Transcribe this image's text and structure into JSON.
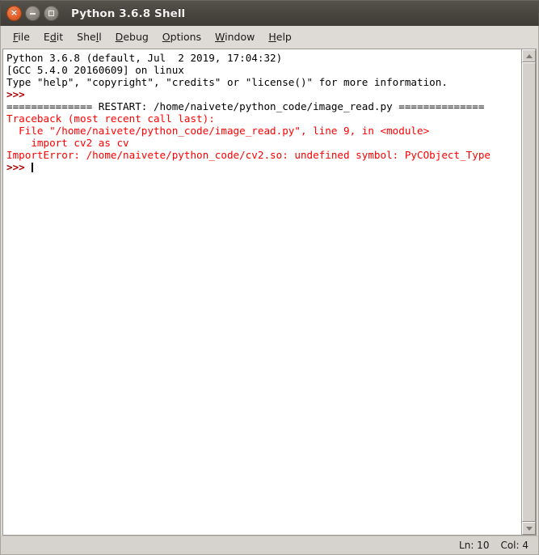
{
  "window": {
    "title": "Python 3.6.8 Shell",
    "controls": [
      {
        "name": "close",
        "glyph": "×"
      },
      {
        "name": "minimize",
        "glyph": "−"
      },
      {
        "name": "maximize",
        "glyph": "□"
      }
    ]
  },
  "menubar": {
    "items": [
      {
        "label": "File",
        "pre": "",
        "mnemonic": "F",
        "post": "ile"
      },
      {
        "label": "Edit",
        "pre": "E",
        "mnemonic": "d",
        "post": "it"
      },
      {
        "label": "Shell",
        "pre": "She",
        "mnemonic": "l",
        "post": "l"
      },
      {
        "label": "Debug",
        "pre": "",
        "mnemonic": "D",
        "post": "ebug"
      },
      {
        "label": "Options",
        "pre": "",
        "mnemonic": "O",
        "post": "ptions"
      },
      {
        "label": "Window",
        "pre": "",
        "mnemonic": "W",
        "post": "indow"
      },
      {
        "label": "Help",
        "pre": "",
        "mnemonic": "H",
        "post": "elp"
      }
    ]
  },
  "shell": {
    "lines": [
      {
        "text": "Python 3.6.8 (default, Jul  2 2019, 17:04:32)",
        "color": "black"
      },
      {
        "text": "[GCC 5.4.0 20160609] on linux",
        "color": "black"
      },
      {
        "text": "Type \"help\", \"copyright\", \"credits\" or \"license()\" for more information.",
        "color": "black"
      },
      {
        "text": ">>>",
        "color": "prompt"
      },
      {
        "text": "============== RESTART: /home/naivete/python_code/image_read.py ==============",
        "color": "black"
      },
      {
        "text": "Traceback (most recent call last):",
        "color": "red"
      },
      {
        "text": "  File \"/home/naivete/python_code/image_read.py\", line 9, in <module>",
        "color": "red"
      },
      {
        "text": "    import cv2 as cv",
        "color": "red"
      },
      {
        "text": "ImportError: /home/naivete/python_code/cv2.so: undefined symbol: PyCObject_Type",
        "color": "red"
      },
      {
        "text": ">>> ",
        "color": "prompt",
        "cursor": true
      }
    ]
  },
  "scrollbar": {
    "up_arrow": "scroll-up",
    "down_arrow": "scroll-down"
  },
  "statusbar": {
    "line_label": "Ln: 10",
    "col_label": "Col: 4"
  }
}
